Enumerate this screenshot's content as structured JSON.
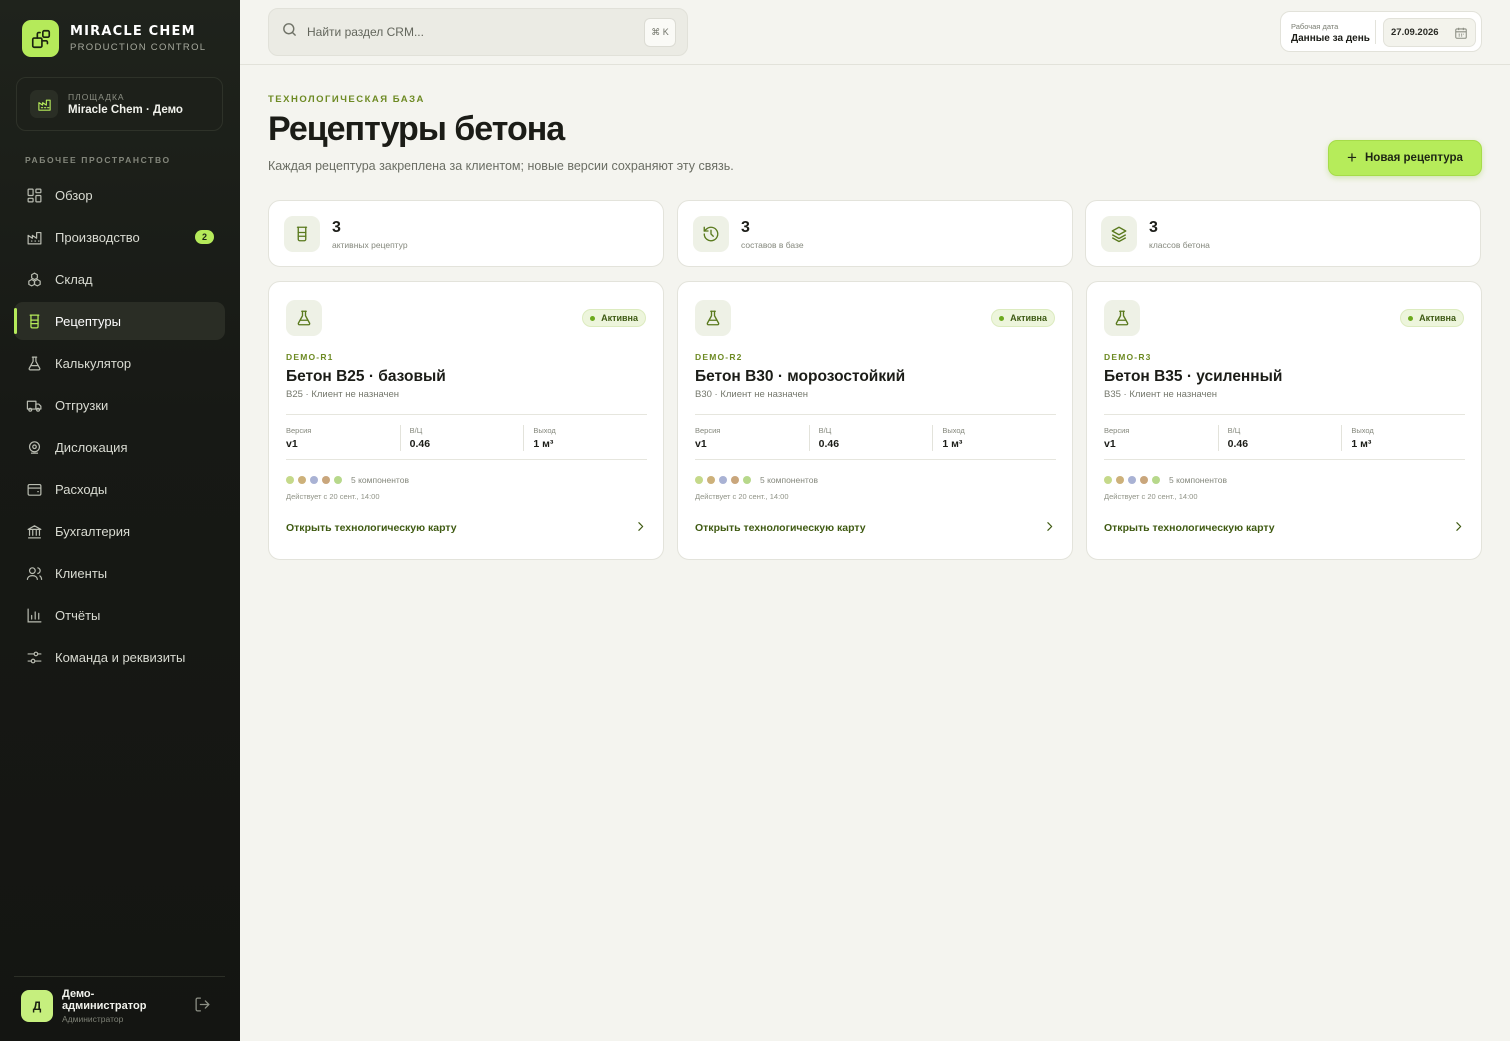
{
  "brand": {
    "name": "MIRACLE CHEM",
    "subtitle": "PRODUCTION CONTROL",
    "accent": "#b5ea5a"
  },
  "site": {
    "label": "ПЛОЩАДКА",
    "value": "Miracle Chem · Демо"
  },
  "sidebar": {
    "section_label": "РАБОЧЕЕ ПРОСТРАНСТВО",
    "items": [
      {
        "label": "Обзор",
        "icon": "grid-icon"
      },
      {
        "label": "Производство",
        "icon": "factory-icon",
        "badge": "2"
      },
      {
        "label": "Склад",
        "icon": "boxes-icon"
      },
      {
        "label": "Рецептуры",
        "icon": "beaker-icon",
        "active": true
      },
      {
        "label": "Калькулятор",
        "icon": "flask-icon"
      },
      {
        "label": "Отгрузки",
        "icon": "truck-icon"
      },
      {
        "label": "Дислокация",
        "icon": "map-pin-icon"
      },
      {
        "label": "Расходы",
        "icon": "wallet-icon"
      },
      {
        "label": "Бухгалтерия",
        "icon": "bank-icon"
      },
      {
        "label": "Клиенты",
        "icon": "users-icon"
      },
      {
        "label": "Отчёты",
        "icon": "bar-chart-icon"
      },
      {
        "label": "Команда и реквизиты",
        "icon": "sliders-icon"
      }
    ]
  },
  "user": {
    "initial": "Д",
    "name": "Демо-администратор",
    "role": "Администратор"
  },
  "search": {
    "placeholder": "Найти раздел CRM...",
    "shortcut": "⌘ K"
  },
  "workdate": {
    "label": "Рабочая дата",
    "value": "Данные за день",
    "date": "27.09.2026"
  },
  "header": {
    "eyebrow": "ТЕХНОЛОГИЧЕСКАЯ БАЗА",
    "title": "Рецептуры бетона",
    "description": "Каждая рецептура закреплена за клиентом; новые версии сохраняют эту связь.",
    "new_button": "Новая рецептура"
  },
  "stats": [
    {
      "value": "3",
      "label": "активных рецептур",
      "icon": "beaker-icon"
    },
    {
      "value": "3",
      "label": "составов в базе",
      "icon": "history-icon"
    },
    {
      "value": "3",
      "label": "классов бетона",
      "icon": "layers-icon"
    }
  ],
  "recipes": [
    {
      "code": "DEMO-R1",
      "title": "Бетон B25 · базовый",
      "subtitle": "B25 · Клиент не назначен",
      "status": "Активна",
      "metrics": [
        {
          "label": "Версия",
          "value": "v1"
        },
        {
          "label": "В/Ц",
          "value": "0.46"
        },
        {
          "label": "Выход",
          "value": "1 м³"
        }
      ],
      "components": "5 компонентов",
      "since": "Действует с 20 сент., 14:00",
      "link": "Открыть технологическую карту"
    },
    {
      "code": "DEMO-R2",
      "title": "Бетон B30 · морозостойкий",
      "subtitle": "B30 · Клиент не назначен",
      "status": "Активна",
      "metrics": [
        {
          "label": "Версия",
          "value": "v1"
        },
        {
          "label": "В/Ц",
          "value": "0.46"
        },
        {
          "label": "Выход",
          "value": "1 м³"
        }
      ],
      "components": "5 компонентов",
      "since": "Действует с 20 сент., 14:00",
      "link": "Открыть технологическую карту"
    },
    {
      "code": "DEMO-R3",
      "title": "Бетон B35 · усиленный",
      "subtitle": "B35 · Клиент не назначен",
      "status": "Активна",
      "metrics": [
        {
          "label": "Версия",
          "value": "v1"
        },
        {
          "label": "В/Ц",
          "value": "0.46"
        },
        {
          "label": "Выход",
          "value": "1 м³"
        }
      ],
      "components": "5 компонентов",
      "since": "Действует с 20 сент., 14:00",
      "link": "Открыть технологическую карту"
    }
  ],
  "component_colors": [
    "#c5d98a",
    "#cdb17a",
    "#a9b2d4",
    "#c9a67c",
    "#b7d88b"
  ]
}
